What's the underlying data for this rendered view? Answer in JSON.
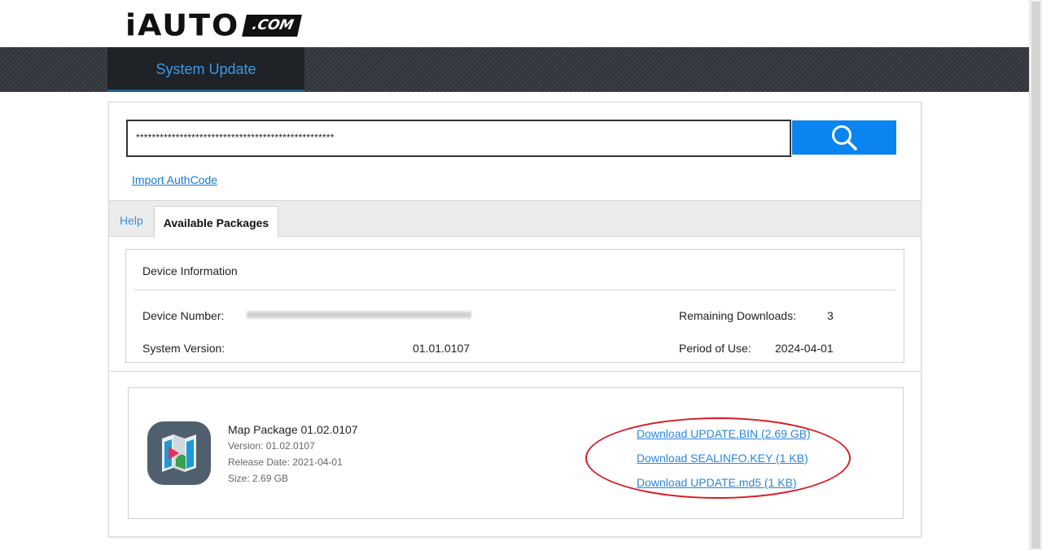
{
  "brand": {
    "logo_main": "iAUTO",
    "logo_com": ".COM"
  },
  "nav": {
    "active_tab": "System Update"
  },
  "auth": {
    "input_value": "**************************************************"
  },
  "links": {
    "import_auth": "Import AuthCode"
  },
  "tabs": {
    "help": "Help",
    "available_packages": "Available Packages"
  },
  "device": {
    "title": "Device Information",
    "device_number_label": "Device Number:",
    "system_version_label": "System Version:",
    "system_version_value": "01.01.0107",
    "remaining_label": "Remaining Downloads:",
    "remaining_value": "3",
    "period_label": "Period of Use:",
    "period_value": "2024-04-01"
  },
  "package": {
    "name": "Map Package 01.02.0107",
    "version": "Version: 01.02.0107",
    "release_date": "Release Date: 2021-04-01",
    "size": "Size: 2.69 GB"
  },
  "downloads": [
    "Download UPDATE.BIN (2.69 GB)",
    "Download SEALINFO.KEY (1 KB)",
    "Download UPDATE.md5 (1 KB)"
  ],
  "colors": {
    "accent": "#0a84f0",
    "link": "#2a86e0",
    "nav_tab_text": "#3a9be8",
    "annotation": "#d81b24"
  },
  "icons": {
    "search": "search-icon",
    "package": "map-package-icon"
  }
}
